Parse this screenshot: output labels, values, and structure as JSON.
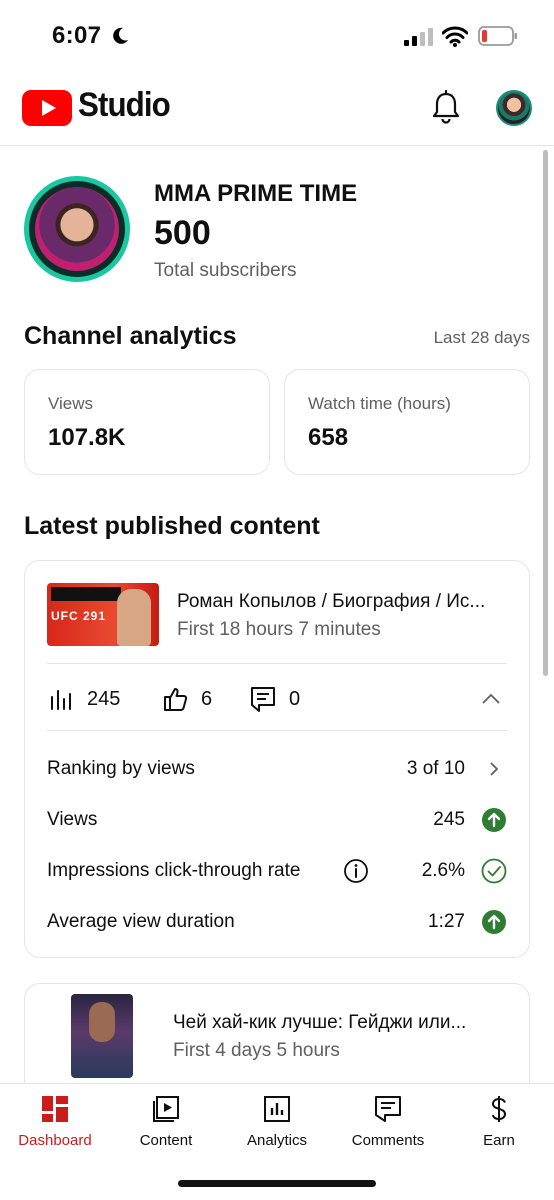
{
  "status_bar": {
    "time": "6:07",
    "icons": [
      "moon-icon",
      "signal-icon",
      "wifi-icon",
      "battery-icon"
    ]
  },
  "header": {
    "app_name": "Studio",
    "icons": [
      "youtube-logo",
      "bell-icon",
      "profile-avatar"
    ]
  },
  "channel": {
    "name": "MMA PRIME TIME",
    "subscribers": "500",
    "subscribers_label": "Total subscribers"
  },
  "analytics": {
    "title": "Channel analytics",
    "period": "Last 28 days",
    "cards": [
      {
        "label": "Views",
        "value": "107.8K"
      },
      {
        "label": "Watch time (hours)",
        "value": "658"
      }
    ]
  },
  "latest": {
    "title": "Latest published content",
    "video1": {
      "title": "Роман Копылов / Биография / Ис...",
      "meta": "First 18 hours 7 minutes",
      "views": "245",
      "likes": "6",
      "comments": "0",
      "rows": [
        {
          "label": "Ranking by views",
          "value": "3 of 10",
          "status": "chevron-right-icon"
        },
        {
          "label": "Views",
          "value": "245",
          "status": "arrow-up-circle-icon"
        },
        {
          "label": "Impressions click-through rate",
          "value": "2.6%",
          "status": "check-circle-icon"
        },
        {
          "label": "Average view duration",
          "value": "1:27",
          "status": "arrow-up-circle-icon"
        }
      ]
    },
    "video2": {
      "title": "Чей хай-кик лучше: Гейджи или...",
      "meta": "First 4 days 5 hours"
    }
  },
  "nav": [
    {
      "label": "Dashboard",
      "icon": "dashboard-icon",
      "active": true
    },
    {
      "label": "Content",
      "icon": "content-icon",
      "active": false
    },
    {
      "label": "Analytics",
      "icon": "analytics-icon",
      "active": false
    },
    {
      "label": "Comments",
      "icon": "comments-icon",
      "active": false
    },
    {
      "label": "Earn",
      "icon": "dollar-icon",
      "active": false
    }
  ],
  "colors": {
    "brand_red": "#ff0000",
    "active_nav": "#cc1b1b",
    "success_green": "#2e7d32",
    "secondary_text": "#606060"
  }
}
